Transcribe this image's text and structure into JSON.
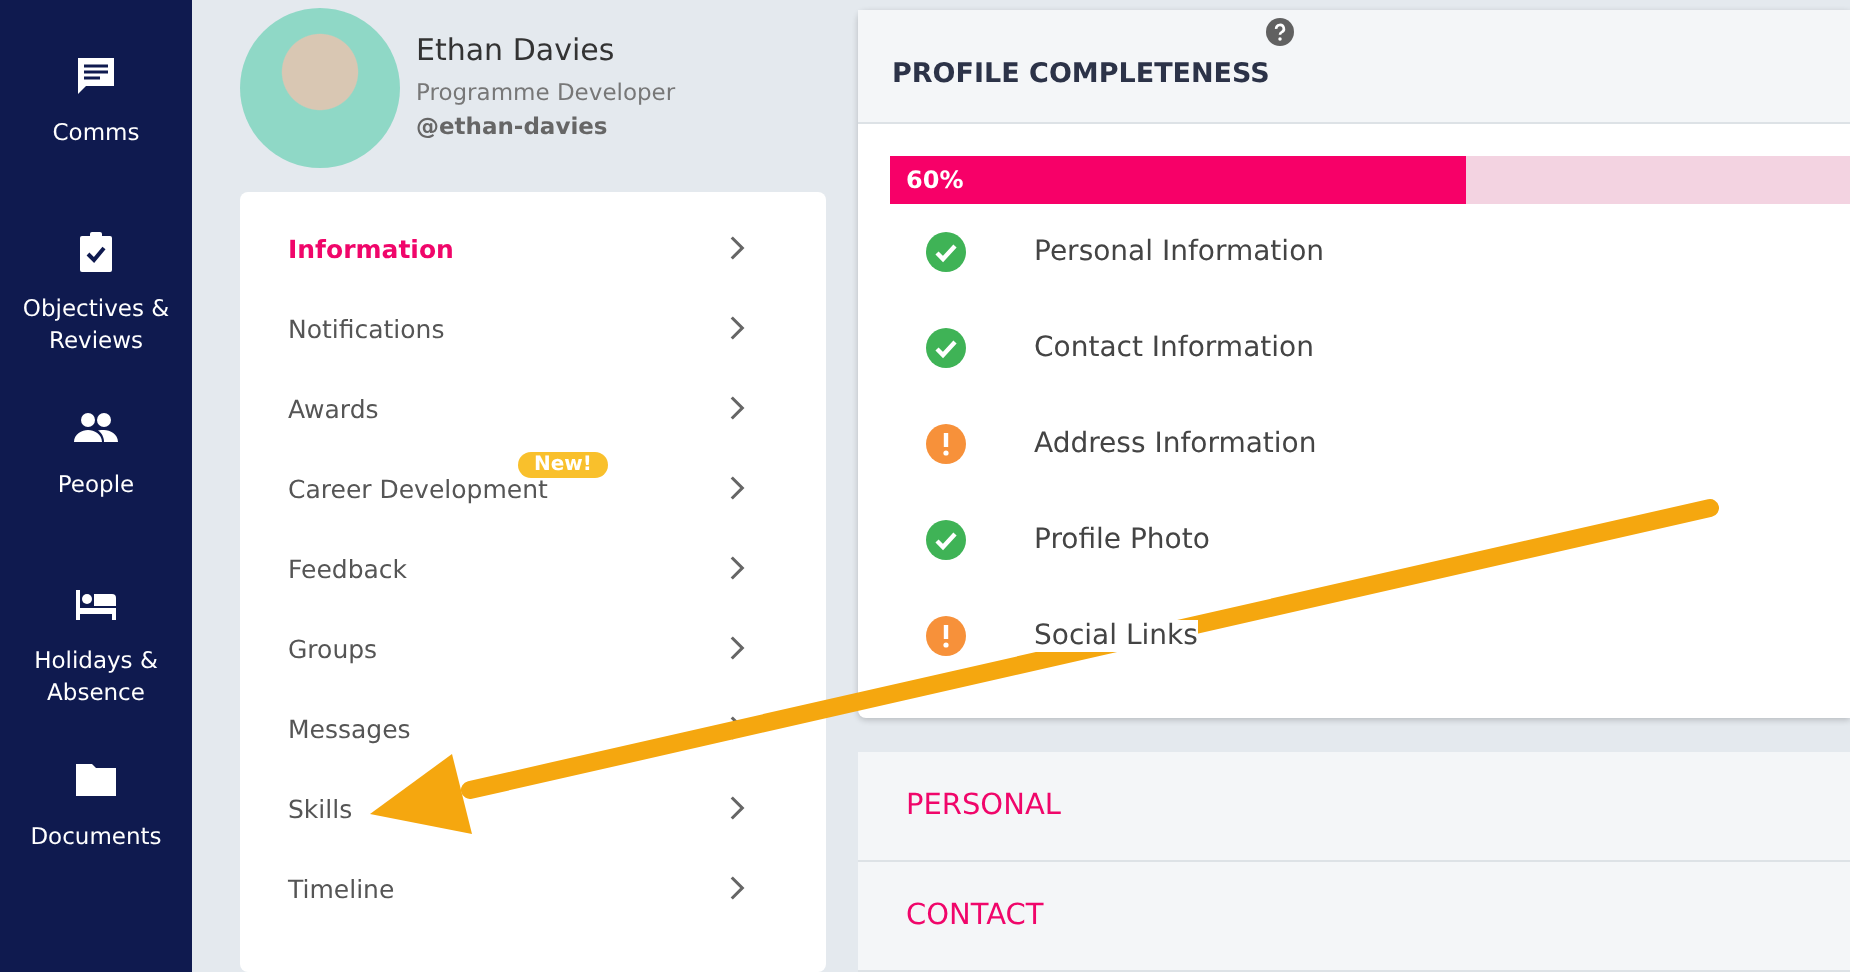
{
  "sidebar": {
    "items": [
      {
        "label": "Comms"
      },
      {
        "label": "Objectives & Reviews"
      },
      {
        "label": "People"
      },
      {
        "label": "Holidays & Absence"
      },
      {
        "label": "Documents"
      }
    ]
  },
  "profile": {
    "name": "Ethan Davies",
    "role": "Programme Developer",
    "handle": "@ethan-davies"
  },
  "menu": {
    "items": [
      {
        "label": "Information",
        "selected": true
      },
      {
        "label": "Notifications",
        "selected": false
      },
      {
        "label": "Awards",
        "selected": false
      },
      {
        "label": "Career Development",
        "selected": false,
        "badge": "New!"
      },
      {
        "label": "Feedback",
        "selected": false
      },
      {
        "label": "Groups",
        "selected": false
      },
      {
        "label": "Messages",
        "selected": false
      },
      {
        "label": "Skills",
        "selected": false
      },
      {
        "label": "Timeline",
        "selected": false
      }
    ]
  },
  "completeness": {
    "title": "PROFILE COMPLETENESS",
    "level": 0.6,
    "reading": "60%",
    "items": [
      {
        "label": "Personal Information",
        "complete": true
      },
      {
        "label": "Contact Information",
        "complete": true
      },
      {
        "label": "Address Information",
        "complete": false
      },
      {
        "label": "Profile Photo",
        "complete": true
      },
      {
        "label": "Social Links",
        "complete": false
      }
    ]
  },
  "sections": [
    "PERSONAL",
    "CONTACT"
  ]
}
